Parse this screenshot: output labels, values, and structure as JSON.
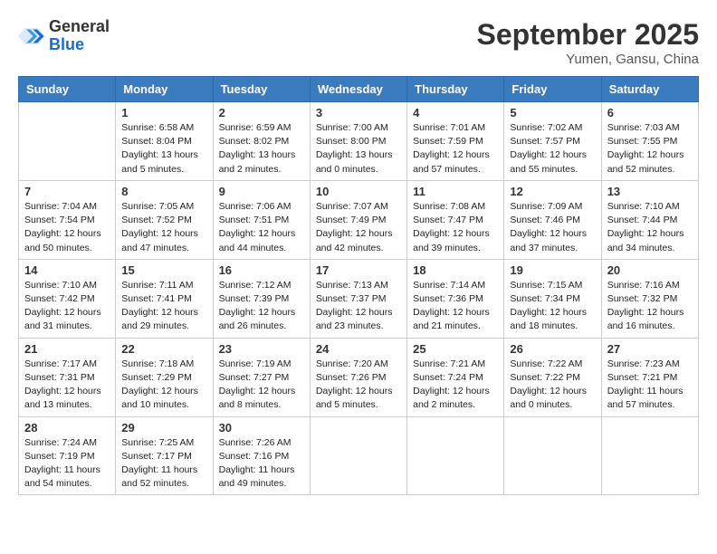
{
  "header": {
    "logo_general": "General",
    "logo_blue": "Blue",
    "month_title": "September 2025",
    "location": "Yumen, Gansu, China"
  },
  "columns": [
    "Sunday",
    "Monday",
    "Tuesday",
    "Wednesday",
    "Thursday",
    "Friday",
    "Saturday"
  ],
  "weeks": [
    [
      {
        "day": null
      },
      {
        "day": "1",
        "sunrise": "6:58 AM",
        "sunset": "8:04 PM",
        "daylight": "13 hours and 5 minutes."
      },
      {
        "day": "2",
        "sunrise": "6:59 AM",
        "sunset": "8:02 PM",
        "daylight": "13 hours and 2 minutes."
      },
      {
        "day": "3",
        "sunrise": "7:00 AM",
        "sunset": "8:00 PM",
        "daylight": "13 hours and 0 minutes."
      },
      {
        "day": "4",
        "sunrise": "7:01 AM",
        "sunset": "7:59 PM",
        "daylight": "12 hours and 57 minutes."
      },
      {
        "day": "5",
        "sunrise": "7:02 AM",
        "sunset": "7:57 PM",
        "daylight": "12 hours and 55 minutes."
      },
      {
        "day": "6",
        "sunrise": "7:03 AM",
        "sunset": "7:55 PM",
        "daylight": "12 hours and 52 minutes."
      }
    ],
    [
      {
        "day": "7",
        "sunrise": "7:04 AM",
        "sunset": "7:54 PM",
        "daylight": "12 hours and 50 minutes."
      },
      {
        "day": "8",
        "sunrise": "7:05 AM",
        "sunset": "7:52 PM",
        "daylight": "12 hours and 47 minutes."
      },
      {
        "day": "9",
        "sunrise": "7:06 AM",
        "sunset": "7:51 PM",
        "daylight": "12 hours and 44 minutes."
      },
      {
        "day": "10",
        "sunrise": "7:07 AM",
        "sunset": "7:49 PM",
        "daylight": "12 hours and 42 minutes."
      },
      {
        "day": "11",
        "sunrise": "7:08 AM",
        "sunset": "7:47 PM",
        "daylight": "12 hours and 39 minutes."
      },
      {
        "day": "12",
        "sunrise": "7:09 AM",
        "sunset": "7:46 PM",
        "daylight": "12 hours and 37 minutes."
      },
      {
        "day": "13",
        "sunrise": "7:10 AM",
        "sunset": "7:44 PM",
        "daylight": "12 hours and 34 minutes."
      }
    ],
    [
      {
        "day": "14",
        "sunrise": "7:10 AM",
        "sunset": "7:42 PM",
        "daylight": "12 hours and 31 minutes."
      },
      {
        "day": "15",
        "sunrise": "7:11 AM",
        "sunset": "7:41 PM",
        "daylight": "12 hours and 29 minutes."
      },
      {
        "day": "16",
        "sunrise": "7:12 AM",
        "sunset": "7:39 PM",
        "daylight": "12 hours and 26 minutes."
      },
      {
        "day": "17",
        "sunrise": "7:13 AM",
        "sunset": "7:37 PM",
        "daylight": "12 hours and 23 minutes."
      },
      {
        "day": "18",
        "sunrise": "7:14 AM",
        "sunset": "7:36 PM",
        "daylight": "12 hours and 21 minutes."
      },
      {
        "day": "19",
        "sunrise": "7:15 AM",
        "sunset": "7:34 PM",
        "daylight": "12 hours and 18 minutes."
      },
      {
        "day": "20",
        "sunrise": "7:16 AM",
        "sunset": "7:32 PM",
        "daylight": "12 hours and 16 minutes."
      }
    ],
    [
      {
        "day": "21",
        "sunrise": "7:17 AM",
        "sunset": "7:31 PM",
        "daylight": "12 hours and 13 minutes."
      },
      {
        "day": "22",
        "sunrise": "7:18 AM",
        "sunset": "7:29 PM",
        "daylight": "12 hours and 10 minutes."
      },
      {
        "day": "23",
        "sunrise": "7:19 AM",
        "sunset": "7:27 PM",
        "daylight": "12 hours and 8 minutes."
      },
      {
        "day": "24",
        "sunrise": "7:20 AM",
        "sunset": "7:26 PM",
        "daylight": "12 hours and 5 minutes."
      },
      {
        "day": "25",
        "sunrise": "7:21 AM",
        "sunset": "7:24 PM",
        "daylight": "12 hours and 2 minutes."
      },
      {
        "day": "26",
        "sunrise": "7:22 AM",
        "sunset": "7:22 PM",
        "daylight": "12 hours and 0 minutes."
      },
      {
        "day": "27",
        "sunrise": "7:23 AM",
        "sunset": "7:21 PM",
        "daylight": "11 hours and 57 minutes."
      }
    ],
    [
      {
        "day": "28",
        "sunrise": "7:24 AM",
        "sunset": "7:19 PM",
        "daylight": "11 hours and 54 minutes."
      },
      {
        "day": "29",
        "sunrise": "7:25 AM",
        "sunset": "7:17 PM",
        "daylight": "11 hours and 52 minutes."
      },
      {
        "day": "30",
        "sunrise": "7:26 AM",
        "sunset": "7:16 PM",
        "daylight": "11 hours and 49 minutes."
      },
      {
        "day": null
      },
      {
        "day": null
      },
      {
        "day": null
      },
      {
        "day": null
      }
    ]
  ]
}
